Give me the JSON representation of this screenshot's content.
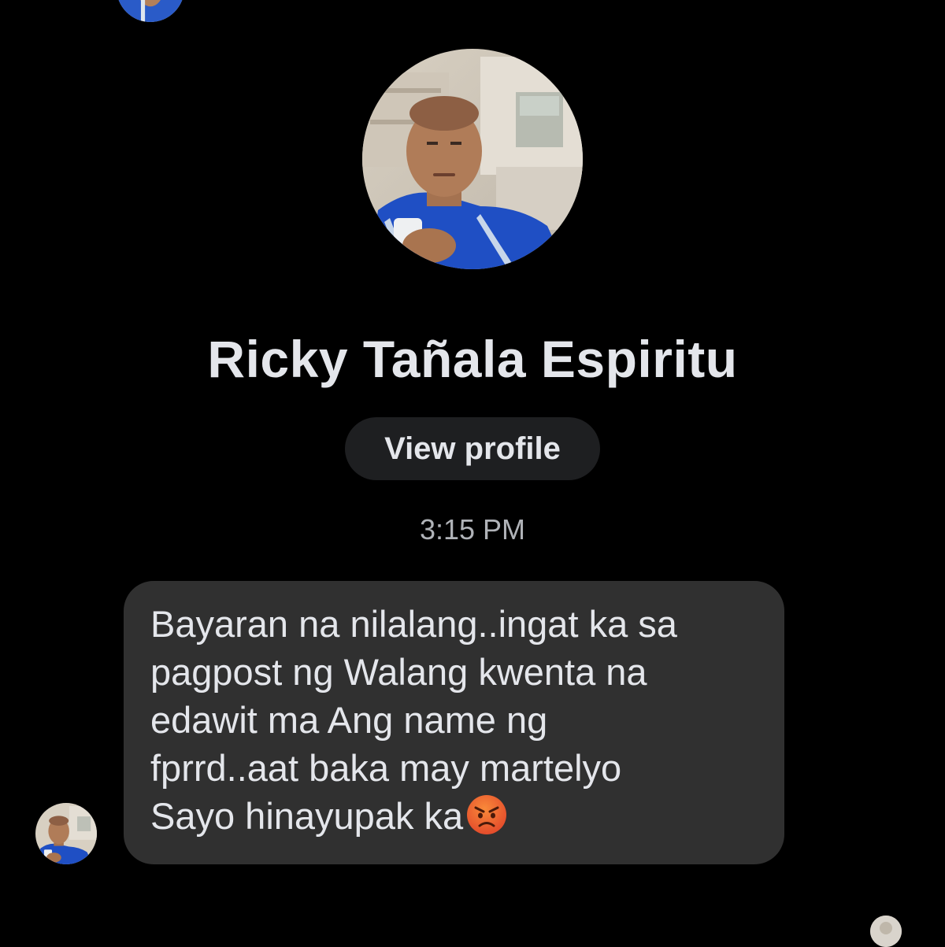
{
  "contact": {
    "name": "Ricky Tañala Espiritu",
    "view_profile_label": "View profile"
  },
  "conversation": {
    "timestamp": "3:15 PM",
    "messages": [
      {
        "sender": "Ricky Tañala Espiritu",
        "lines": [
          "Bayaran na nilalang..ingat ka sa",
          "pagpost ng Walang kwenta na",
          "edawit ma Ang name ng",
          "fprrd..aat baka may martelyo",
          "Sayo hinayupak ka"
        ],
        "trailing_emoji": "angry-face-emoji"
      }
    ]
  },
  "colors": {
    "background": "#000000",
    "bubble": "#303030",
    "button": "#1e1f21",
    "text_primary": "#e4e6eb",
    "text_secondary": "#b0b3b8",
    "emoji": "#f26b2a"
  }
}
